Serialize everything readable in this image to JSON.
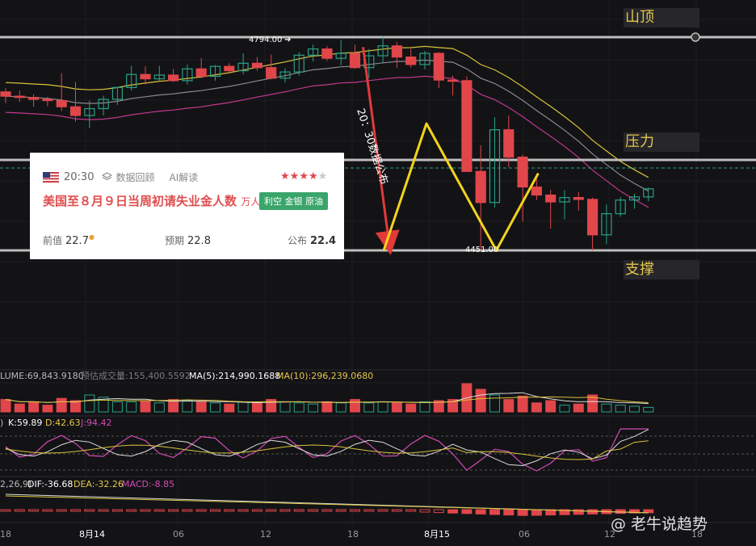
{
  "colors": {
    "up": "#2aa188",
    "down": "#e0464a",
    "annot": "#f2d31c",
    "arrow": "#e23a3a",
    "ma_yellow": "#d8c33a",
    "ma_gray": "#8a8a8a",
    "ma_pink": "#c0398b"
  },
  "levels": {
    "top_price": "4794.00",
    "bottom_price": "4451.00",
    "top_label": "山顶",
    "mid_label": "压力",
    "bottom_label": "支撑"
  },
  "arrow_text": "20：30数据公布",
  "event": {
    "time": "20:30",
    "replay": "数据回顾",
    "ai": "AI解读",
    "title": "美国至８月９日当周初请失业金人数",
    "unit": "万人",
    "tag": "利空 金银 原油",
    "stars_on": 4,
    "stars_total": 5,
    "prev_label": "前值",
    "prev": "22.7",
    "forecast_label": "预期",
    "forecast": "22.8",
    "actual_label": "公布",
    "actual": "22.4"
  },
  "indicators": {
    "volume": {
      "vol": "LUME:69,843.9180",
      "est": "预估成交量:155,400.5592",
      "ma5": "MA(5):214,990.1688",
      "ma10": "MA(10):296,239.0680"
    },
    "kdj": {
      "prefix": ")",
      "k": "K:59.89",
      "d": "D:42.63",
      "j": "J:94.42"
    },
    "macd": {
      "prefix": "2,26,9)",
      "dif": "DIF:-36.68",
      "dea": "DEA:-32.26",
      "macd": "MACD:-8.85"
    }
  },
  "x_axis": [
    "18",
    "8月14",
    "06",
    "12",
    "18",
    "8月15",
    "06",
    "12",
    "18"
  ],
  "watermark": "@ 老牛说趋势",
  "chart_data": {
    "type": "candlestick",
    "title": "",
    "annotated_levels": {
      "peak": 4794.0,
      "support": 4451.0
    },
    "candles": [
      [
        4706,
        4712,
        4688,
        4699
      ],
      [
        4699,
        4708,
        4690,
        4697
      ],
      [
        4697,
        4702,
        4682,
        4694
      ],
      [
        4694,
        4698,
        4683,
        4692
      ],
      [
        4692,
        4736,
        4675,
        4682
      ],
      [
        4682,
        4722,
        4658,
        4668
      ],
      [
        4668,
        4692,
        4648,
        4679
      ],
      [
        4679,
        4700,
        4668,
        4694
      ],
      [
        4694,
        4714,
        4685,
        4713
      ],
      [
        4713,
        4748,
        4708,
        4734
      ],
      [
        4734,
        4747,
        4718,
        4727
      ],
      [
        4727,
        4748,
        4722,
        4733
      ],
      [
        4733,
        4743,
        4722,
        4724
      ],
      [
        4724,
        4750,
        4718,
        4743
      ],
      [
        4743,
        4760,
        4728,
        4731
      ],
      [
        4731,
        4749,
        4724,
        4747
      ],
      [
        4747,
        4752,
        4735,
        4740
      ],
      [
        4740,
        4768,
        4734,
        4752
      ],
      [
        4752,
        4762,
        4740,
        4745
      ],
      [
        4745,
        4766,
        4726,
        4728
      ],
      [
        4728,
        4744,
        4721,
        4738
      ],
      [
        4738,
        4770,
        4732,
        4765
      ],
      [
        4765,
        4782,
        4755,
        4775
      ],
      [
        4775,
        4780,
        4756,
        4760
      ],
      [
        4760,
        4790,
        4749,
        4768
      ],
      [
        4768,
        4782,
        4743,
        4745
      ],
      [
        4745,
        4775,
        4728,
        4764
      ],
      [
        4764,
        4794,
        4752,
        4780
      ],
      [
        4780,
        4786,
        4745,
        4762
      ],
      [
        4762,
        4775,
        4745,
        4750
      ],
      [
        4750,
        4772,
        4742,
        4768
      ],
      [
        4768,
        4770,
        4712,
        4725
      ],
      [
        4725,
        4732,
        4700,
        4724
      ],
      [
        4724,
        4731,
        4585,
        4578
      ],
      [
        4578,
        4620,
        4451,
        4528
      ],
      [
        4528,
        4665,
        4520,
        4645
      ],
      [
        4645,
        4668,
        4585,
        4601
      ],
      [
        4601,
        4605,
        4497,
        4553
      ],
      [
        4553,
        4566,
        4532,
        4540
      ],
      [
        4540,
        4548,
        4486,
        4529
      ],
      [
        4529,
        4548,
        4501,
        4536
      ],
      [
        4536,
        4545,
        4515,
        4533
      ],
      [
        4533,
        4536,
        4451,
        4476
      ],
      [
        4476,
        4525,
        4461,
        4510
      ],
      [
        4510,
        4537,
        4505,
        4532
      ],
      [
        4532,
        4542,
        4518,
        4537
      ],
      [
        4537,
        4552,
        4530,
        4550
      ]
    ]
  }
}
